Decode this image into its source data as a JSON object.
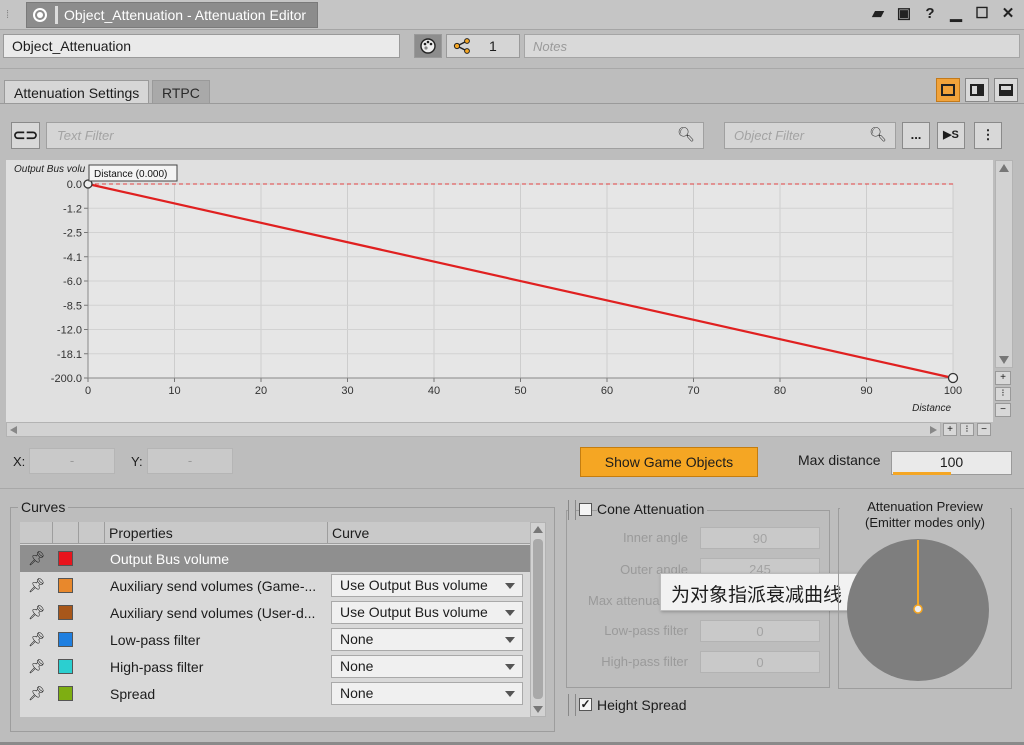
{
  "window": {
    "title": "Object_Attenuation - Attenuation Editor"
  },
  "object": {
    "name": "Object_Attenuation",
    "share_count": "1",
    "notes_placeholder": "Notes"
  },
  "tabs": [
    {
      "label": "Attenuation Settings",
      "active": true
    },
    {
      "label": "RTPC",
      "active": false
    }
  ],
  "filters": {
    "text_placeholder": "Text Filter",
    "object_placeholder": "Object Filter",
    "more_label": "...",
    "overflow_label": "⋮"
  },
  "graph": {
    "y_axis_label": "Output Bus volu",
    "x_axis_label": "Distance",
    "point_tooltip": "Distance (0.000)",
    "y_ticks": [
      "0.0",
      "-1.2",
      "-2.5",
      "-4.1",
      "-6.0",
      "-8.5",
      "-12.0",
      "-18.1",
      "-200.0"
    ],
    "x_ticks": [
      "0",
      "10",
      "20",
      "30",
      "40",
      "50",
      "60",
      "70",
      "80",
      "90",
      "100"
    ],
    "curve_color": "#e02020"
  },
  "chart_data": {
    "type": "line",
    "x": [
      0,
      100
    ],
    "series": [
      {
        "name": "Output Bus volume",
        "values": [
          0.0,
          -200.0
        ]
      }
    ],
    "xlabel": "Distance",
    "ylabel": "Output Bus volu",
    "xlim": [
      0,
      100
    ],
    "y_ticks": [
      0.0,
      -1.2,
      -2.5,
      -4.1,
      -6.0,
      -8.5,
      -12.0,
      -18.1,
      -200.0
    ],
    "grid": true
  },
  "coords": {
    "x_label": "X:",
    "y_label": "Y:",
    "x_value": "-",
    "y_value": "-"
  },
  "buttons": {
    "show_game_objects": "Show Game Objects"
  },
  "max_distance": {
    "label": "Max distance",
    "value": "100",
    "accent": "#f5a623"
  },
  "curves": {
    "group_label": "Curves",
    "columns": [
      "Properties",
      "Curve"
    ],
    "rows": [
      {
        "property": "Output Bus volume",
        "curve": "",
        "color": "#e8141c",
        "selected": true
      },
      {
        "property": "Auxiliary send volumes (Game-...",
        "curve": "Use Output Bus volume",
        "color": "#e8882c",
        "selected": false
      },
      {
        "property": "Auxiliary send volumes (User-d...",
        "curve": "Use Output Bus volume",
        "color": "#a8571a",
        "selected": false
      },
      {
        "property": "Low-pass filter",
        "curve": "None",
        "color": "#1f7fe0",
        "selected": false
      },
      {
        "property": "High-pass filter",
        "curve": "None",
        "color": "#2bcfd0",
        "selected": false
      },
      {
        "property": "Spread",
        "curve": "None",
        "color": "#7eae12",
        "selected": false
      }
    ]
  },
  "cone": {
    "label": "Cone Attenuation",
    "inner_angle_label": "Inner angle",
    "inner_angle": "90",
    "outer_angle_label": "Outer angle",
    "outer_angle": "245",
    "max_atten_label": "Max attenua",
    "lowpass_label": "Low-pass filter",
    "lowpass": "0",
    "highpass_label": "High-pass filter",
    "highpass": "0"
  },
  "tooltip": "为对象指派衰减曲线",
  "height_spread": {
    "label": "Height Spread",
    "checked": true
  },
  "preview": {
    "title": "Attenuation Preview",
    "subtitle": "(Emitter modes only)"
  }
}
